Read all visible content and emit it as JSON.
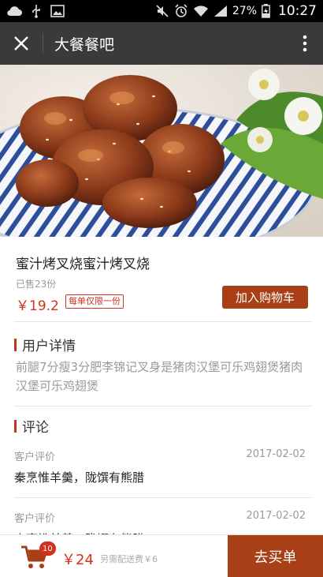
{
  "status_bar": {
    "battery": "27%",
    "time": "10:27",
    "icons": [
      "cloud-icon",
      "usb-icon",
      "image-icon",
      "mute-icon",
      "alarm-icon",
      "wifi-icon",
      "signal-icon",
      "battery-icon"
    ]
  },
  "title_bar": {
    "title": "大餐餐吧",
    "close_icon": "close-icon",
    "more_icon": "more-vertical-icon"
  },
  "product": {
    "name": "蜜汁烤叉烧蜜汁烤叉烧",
    "sold": "已售23份",
    "price": "￥19.2",
    "limit_badge": "每单仅限一份",
    "add_to_cart": "加入购物车"
  },
  "details": {
    "heading": "用户详情",
    "description": "前腿7分瘦3分肥李锦记叉身是猪肉汉堡可乐鸡翅煲猪肉汉堡可乐鸡翅煲"
  },
  "reviews": {
    "heading": "评论",
    "items": [
      {
        "author": "客户评价",
        "date": "2017-02-02",
        "text": "秦烹惟羊羹，陇馔有熊腊"
      },
      {
        "author": "客户评价",
        "date": "2017-02-02",
        "text": "秦烹惟羊羹，陇馔有熊腊"
      }
    ]
  },
  "bottom_bar": {
    "cart_count": "10",
    "total": "￥24",
    "delivery_note": "另需配送费￥6",
    "checkout": "去买单"
  },
  "colors": {
    "accent": "#a93f16",
    "price": "#d0321e",
    "titlebar": "#3a3a3c"
  }
}
